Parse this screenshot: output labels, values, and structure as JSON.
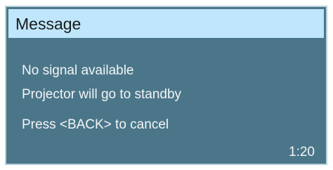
{
  "dialog": {
    "title": "Message",
    "lines": [
      "No signal available",
      "Projector will go to standby",
      "Press <BACK> to cancel"
    ],
    "countdown": "1:20"
  }
}
